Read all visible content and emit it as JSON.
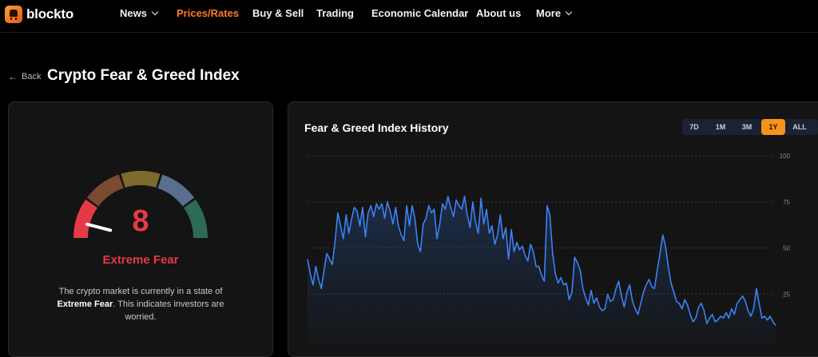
{
  "nav": {
    "brand": "blockto",
    "items": [
      {
        "label": "News",
        "dropdown": true,
        "active": false
      },
      {
        "label": "Prices/Rates",
        "dropdown": false,
        "active": true
      },
      {
        "label": "Buy & Sell",
        "dropdown": false,
        "active": false
      },
      {
        "label": "Trading",
        "dropdown": false,
        "active": false
      },
      {
        "label": "Economic Calendar",
        "dropdown": false,
        "active": false
      },
      {
        "label": "About us",
        "dropdown": false,
        "active": false
      },
      {
        "label": "More",
        "dropdown": true,
        "active": false
      }
    ]
  },
  "header": {
    "back_label": "Back",
    "title": "Crypto Fear & Greed Index"
  },
  "gauge": {
    "value": "8",
    "value_number": 8,
    "label": "Extreme Fear",
    "desc_prefix": "The crypto market is currently in a state of ",
    "desc_strong": "Extreme Fear",
    "desc_suffix": ". This indicates investors are worried.",
    "segment_colors": [
      "#e63946",
      "#7a4a32",
      "#7d6a2d",
      "#5a6f8e",
      "#2d6b58"
    ],
    "value_color": "#e63946"
  },
  "history": {
    "title": "Fear & Greed Index History",
    "ranges": [
      {
        "label": "7D",
        "active": false
      },
      {
        "label": "1M",
        "active": false
      },
      {
        "label": "3M",
        "active": false
      },
      {
        "label": "1Y",
        "active": true
      },
      {
        "label": "ALL",
        "active": false
      }
    ]
  },
  "chart_data": {
    "type": "line",
    "ylim": [
      0,
      100
    ],
    "yticks": [
      "100",
      "75",
      "50",
      "25"
    ],
    "ytick_values": [
      100,
      75,
      50,
      25
    ],
    "grid": true,
    "line_color": "#3b82f6",
    "values": [
      44,
      36,
      30,
      40,
      33,
      28,
      38,
      47,
      44,
      41,
      54,
      69,
      62,
      55,
      68,
      58,
      66,
      72,
      70,
      62,
      72,
      56,
      69,
      73,
      67,
      74,
      71,
      74,
      66,
      75,
      70,
      63,
      72,
      62,
      57,
      54,
      73,
      62,
      73,
      66,
      52,
      48,
      63,
      66,
      73,
      69,
      71,
      55,
      63,
      74,
      71,
      78,
      72,
      67,
      76,
      73,
      71,
      78,
      68,
      61,
      75,
      64,
      58,
      77,
      63,
      71,
      58,
      62,
      52,
      57,
      68,
      55,
      61,
      44,
      60,
      48,
      53,
      49,
      51,
      46,
      43,
      52,
      48,
      40,
      40,
      35,
      32,
      73,
      68,
      47,
      36,
      31,
      34,
      30,
      31,
      22,
      26,
      45,
      42,
      38,
      28,
      23,
      19,
      27,
      20,
      23,
      18,
      16,
      17,
      25,
      21,
      22,
      28,
      32,
      24,
      18,
      26,
      30,
      21,
      17,
      14,
      20,
      26,
      30,
      33,
      29,
      28,
      38,
      47,
      57,
      51,
      40,
      31,
      26,
      21,
      20,
      17,
      22,
      19,
      14,
      10,
      12,
      18,
      20,
      16,
      9,
      12,
      14,
      10,
      11,
      13,
      12,
      15,
      12,
      17,
      14,
      20,
      22,
      24,
      21,
      16,
      13,
      17,
      28,
      20,
      12,
      13,
      11,
      13,
      10,
      8
    ]
  }
}
